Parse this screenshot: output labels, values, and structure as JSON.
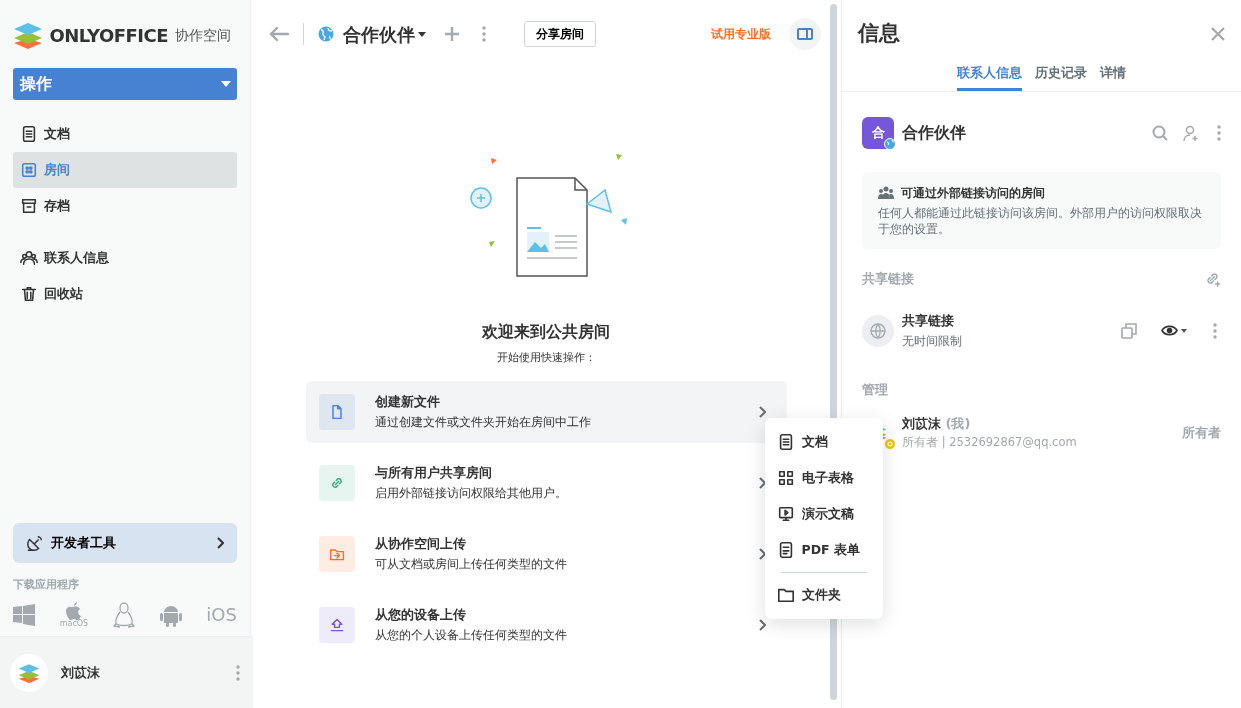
{
  "sidebar": {
    "logo": {
      "brand": "ONLYOFFICE",
      "product": "协作空间"
    },
    "action_button": "操作",
    "nav_groups": [
      {
        "items": [
          {
            "label": "文档",
            "selected": false
          },
          {
            "label": "房间",
            "selected": true
          },
          {
            "label": "存档",
            "selected": false
          }
        ]
      },
      {
        "items": [
          {
            "label": "联系人信息",
            "selected": false
          },
          {
            "label": "回收站",
            "selected": false
          }
        ]
      }
    ],
    "developer_tools": "开发者工具",
    "downloads": {
      "title": "下载应用程序",
      "apps": [
        {
          "kind": "windows"
        },
        {
          "kind": "macos",
          "label": "macOS"
        },
        {
          "kind": "linux"
        },
        {
          "kind": "android"
        },
        {
          "kind": "ios",
          "label": "iOS"
        }
      ]
    },
    "user": {
      "name": "刘苡沫"
    }
  },
  "header": {
    "room_title": "合作伙伴",
    "share_button": "分享房间",
    "trial_link": "试用专业版"
  },
  "empty_state": {
    "title": "欢迎来到公共房间",
    "subtitle": "开始使用快速操作：",
    "actions": [
      {
        "title": "创建新文件",
        "description": "通过创建文件或文件夹开始在房间中工作",
        "color": "#4781d1",
        "selected": true
      },
      {
        "title": "与所有用户共享房间",
        "description": "启用外部链接访问权限给其他用户。",
        "color": "#35ad7d",
        "selected": false
      },
      {
        "title": "从协作空间上传",
        "description": "可从文档或房间上传任何类型的文件",
        "color": "#ff6f1e",
        "selected": false
      },
      {
        "title": "从您的设备上传",
        "description": "从您的个人设备上传任何类型的文件",
        "color": "#7757d9",
        "selected": false
      }
    ]
  },
  "create_menu": {
    "groups": [
      {
        "items": [
          {
            "label": "文档"
          },
          {
            "label": "电子表格"
          },
          {
            "label": "演示文稿"
          },
          {
            "label": "PDF 表单"
          }
        ]
      },
      {
        "items": [
          {
            "label": "文件夹"
          }
        ]
      }
    ]
  },
  "info_panel": {
    "title": "信息",
    "tabs": [
      {
        "label": "联系人信息",
        "selected": true
      },
      {
        "label": "历史记录",
        "selected": false
      },
      {
        "label": "详情",
        "selected": false
      }
    ],
    "room": {
      "avatar_letter": "合",
      "name": "合作伙伴"
    },
    "notice": {
      "title": "可通过外部链接访问的房间",
      "text": "任何人都能通过此链接访问该房间。外部用户的访问权限取决于您的设置。"
    },
    "share_links": {
      "title": "共享链接",
      "links": [
        {
          "name": "共享链接",
          "expiry": "无时间限制"
        }
      ]
    },
    "managers": {
      "title": "管理",
      "members": [
        {
          "name": "刘苡沫",
          "me_tag": "(我)",
          "subtitle": "所有者 | 2532692867@qq.com",
          "role": "所有者"
        }
      ]
    }
  }
}
